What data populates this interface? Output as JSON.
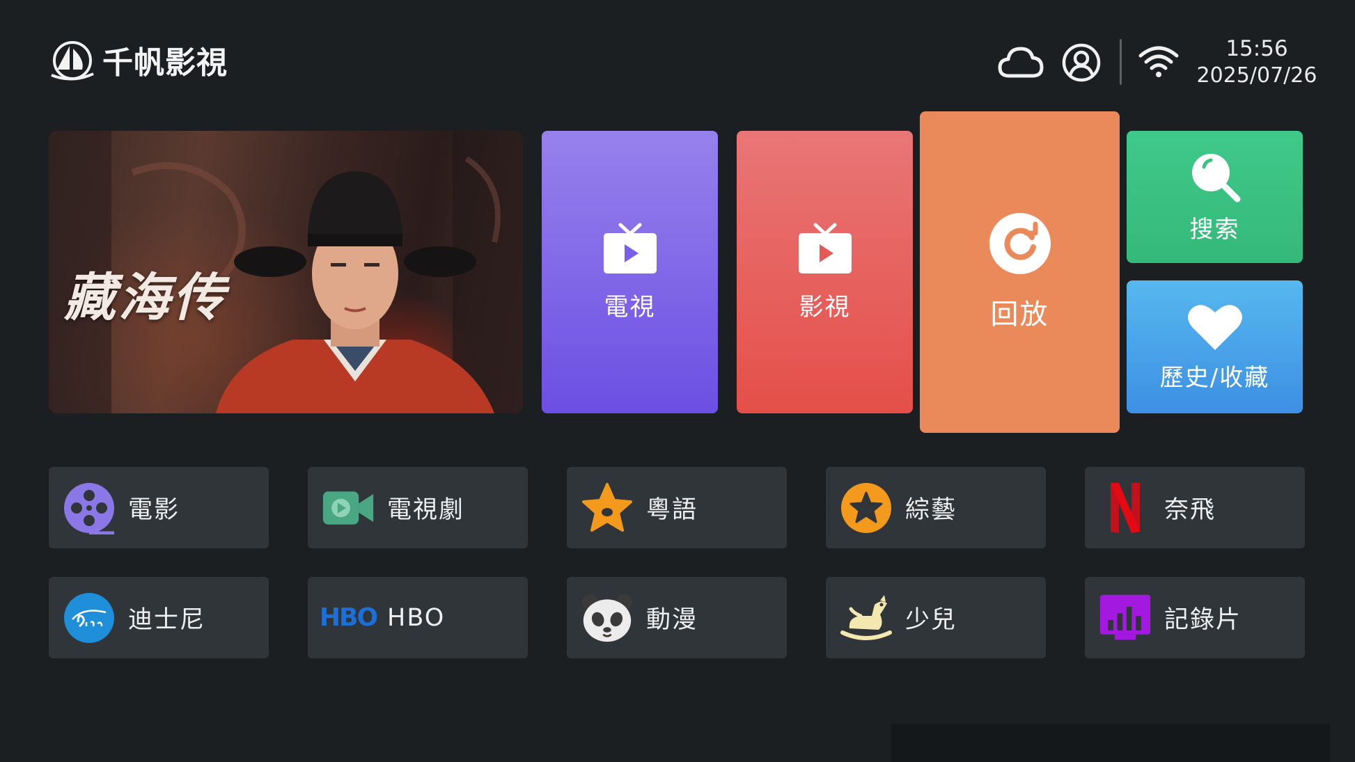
{
  "header": {
    "app_title": "千帆影視",
    "time": "15:56",
    "date": "2025/07/26"
  },
  "banner": {
    "title": "藏海传"
  },
  "tiles": {
    "tv": "電視",
    "movie": "影視",
    "replay": "回放",
    "search": "搜索",
    "history": "歷史/收藏"
  },
  "categories": [
    {
      "label": "電影",
      "icon": "film-reel-icon"
    },
    {
      "label": "電視劇",
      "icon": "video-camera-icon"
    },
    {
      "label": "粵語",
      "icon": "star-icon"
    },
    {
      "label": "綜藝",
      "icon": "star-circle-icon"
    },
    {
      "label": "奈飛",
      "icon": "netflix-icon"
    },
    {
      "label": "迪士尼",
      "icon": "disney-icon"
    },
    {
      "label": "HBO",
      "icon": "hbo-icon",
      "logo_text": "HBO"
    },
    {
      "label": "動漫",
      "icon": "panda-icon"
    },
    {
      "label": "少兒",
      "icon": "rocking-horse-icon"
    },
    {
      "label": "記錄片",
      "icon": "bar-chart-icon"
    }
  ],
  "colors": {
    "background": "#1b1f22",
    "tv_tile": "#7b61e8",
    "movie_tile": "#e65a55",
    "replay_tile": "#ea8a5a",
    "search_tile": "#3bc283",
    "history_tile": "#4aa3ea",
    "category_button": "#30353a"
  }
}
